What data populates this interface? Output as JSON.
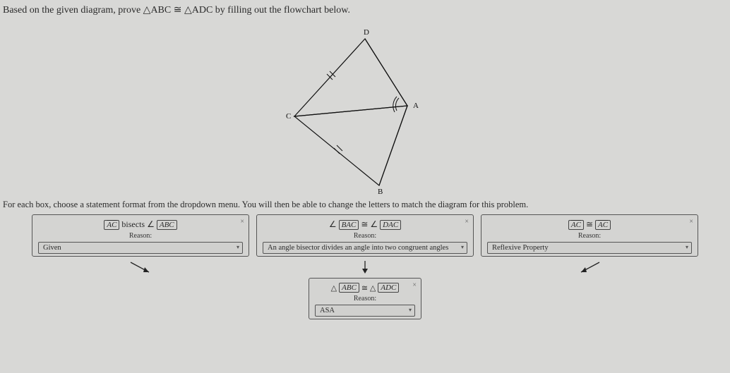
{
  "prompt": {
    "prefix": "Based on the given diagram, prove ",
    "tri1": "△ABC",
    "cong": " ≅ ",
    "tri2": "△ADC",
    "suffix": " by filling out the flowchart below."
  },
  "diagram_labels": {
    "A": "A",
    "B": "B",
    "C": "C",
    "D": "D"
  },
  "instruction": "For each box, choose a statement format from the dropdown menu. You will then be able to change the letters to match the diagram for this problem.",
  "boxes": {
    "b1": {
      "seg": "AC",
      "mid": " bisects ∠",
      "ang": "ABC",
      "reason_label": "Reason:",
      "reason_value": "Given"
    },
    "b2": {
      "pre": "∠",
      "left": "BAC",
      "cong": " ≅ ∠",
      "right": "DAC",
      "reason_label": "Reason:",
      "reason_value": "An angle bisector divides an angle into two congruent angles"
    },
    "b3": {
      "left": "AC",
      "cong": " ≅ ",
      "right": "AC",
      "reason_label": "Reason:",
      "reason_value": "Reflexive Property"
    },
    "b4": {
      "pre": "△",
      "left": "ABC",
      "cong": " ≅ △",
      "right": "ADC",
      "reason_label": "Reason:",
      "reason_value": "ASA"
    }
  },
  "close": "×"
}
